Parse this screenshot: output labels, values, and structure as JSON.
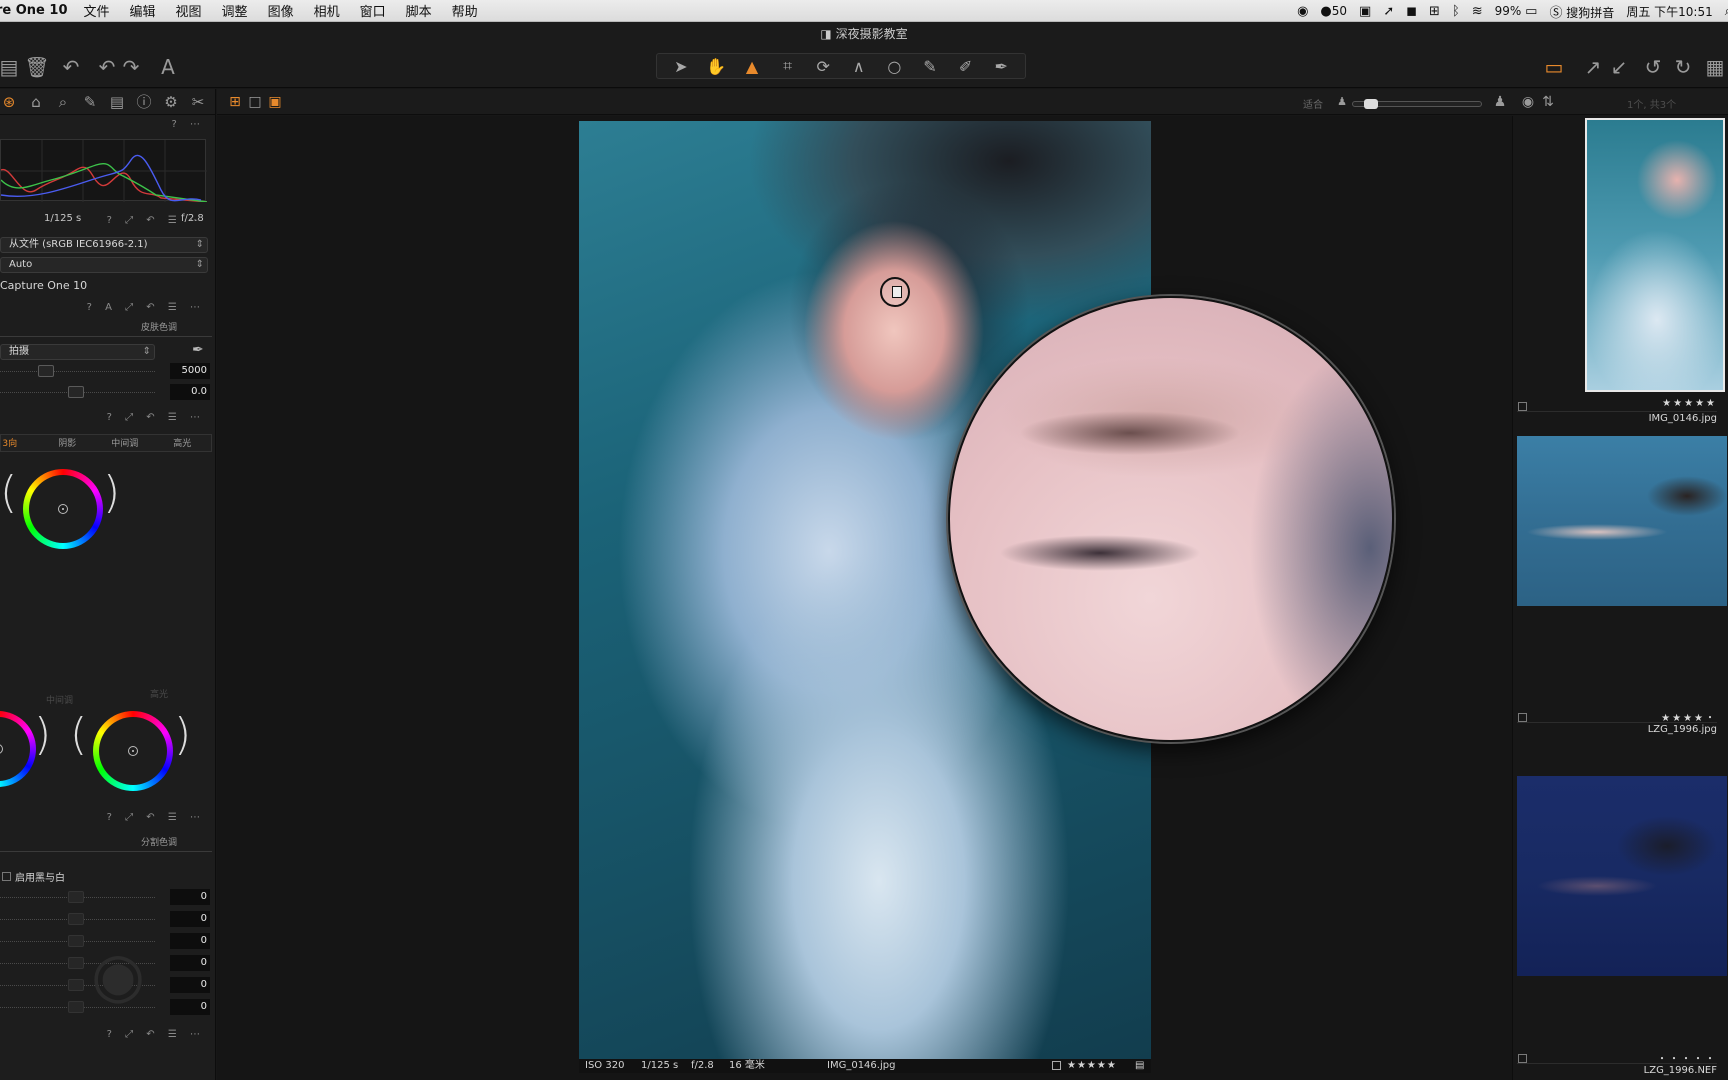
{
  "menubar": {
    "app_name": "re One 10",
    "items": [
      "文件",
      "编辑",
      "视图",
      "调整",
      "图像",
      "相机",
      "窗口",
      "脚本",
      "帮助"
    ],
    "notification_count": "50",
    "battery": "99%",
    "input_method": "搜狗拼音",
    "clock": "周五 下午10:51"
  },
  "window": {
    "title": "深夜摄影教室"
  },
  "toolbar": {
    "text_tool_label": "A"
  },
  "left_panel": {
    "histogram": {
      "shutter": "1/125 s",
      "aperture": "f/2.8"
    },
    "icc_profile": "从文件 (sRGB IEC61966-2.1)",
    "curve_mode": "Auto",
    "engine": "Capture One 10",
    "white_balance": {
      "tab_skin": "皮肤色调",
      "mode": "拍摄",
      "kelvin": "5000",
      "tint": "0.0"
    },
    "color_balance": {
      "tabs": [
        "3向",
        "阴影",
        "中间调",
        "高光"
      ],
      "label_mid": "中间调",
      "label_high": "高光"
    },
    "black_white": {
      "tab_split": "分割色调",
      "tab_active_fragment": "",
      "enable_label": "启用黑与白",
      "values": [
        "0",
        "0",
        "0",
        "0",
        "0",
        "0"
      ]
    }
  },
  "viewer": {
    "zoom_label": "适合",
    "zoom_level": 0.1,
    "photo_info": {
      "iso": "ISO 320",
      "shutter": "1/125 s",
      "aperture": "f/2.8",
      "focal": "16 毫米",
      "filename": "IMG_0146.jpg",
      "stars": "★★★★★"
    }
  },
  "browser": {
    "count": "1个, 共3个",
    "thumbs": [
      {
        "stars": "★★★★★",
        "filename": "IMG_0146.jpg"
      },
      {
        "stars": "★★★★・",
        "filename": "LZG_1996.jpg"
      },
      {
        "stars": "・・・・・",
        "filename": "LZG_1996.NEF"
      }
    ]
  },
  "colors": {
    "accent": "#e88a2c",
    "panel_bg": "#1d1d1d",
    "viewer_bg": "#151515"
  }
}
